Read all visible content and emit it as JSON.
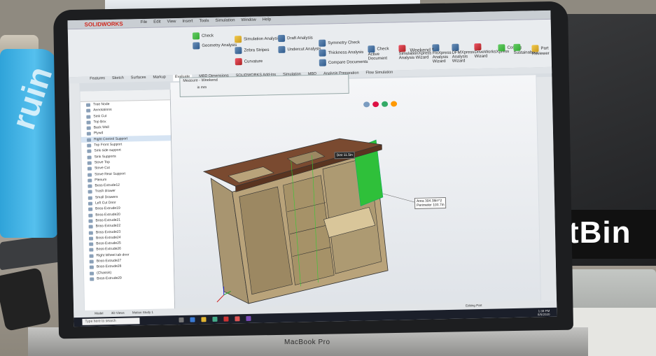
{
  "app": {
    "logo": "SOLIDWORKS",
    "menu": [
      "File",
      "Edit",
      "View",
      "Insert",
      "Tools",
      "Simulation",
      "Window",
      "Help"
    ],
    "document_title": "Weekend *"
  },
  "ribbon": {
    "tools": [
      {
        "label": "Check",
        "icon": "check-icon"
      },
      {
        "label": "Geometry Analysis",
        "icon": "geometry-analysis-icon"
      },
      {
        "label": "Simulation Analysis",
        "icon": "simulation-icon"
      },
      {
        "label": "Draft Analysis",
        "icon": "draft-icon"
      },
      {
        "label": "Zebra Stripes",
        "icon": "zebra-icon"
      },
      {
        "label": "Undercut Analysis",
        "icon": "undercut-icon"
      },
      {
        "label": "Curvature",
        "icon": "curvature-icon"
      },
      {
        "label": "Symmetry Check",
        "icon": "symmetry-icon"
      },
      {
        "label": "Thickness Analysis",
        "icon": "thickness-icon"
      },
      {
        "label": "Compare Documents",
        "icon": "compare-icon"
      },
      {
        "label": "Check Active Document",
        "icon": "check-doc-icon"
      },
      {
        "label": "SimulationXpress Analysis Wizard",
        "icon": "simxpress-icon"
      },
      {
        "label": "FloXpress Analysis Wizard",
        "icon": "floxpress-icon"
      },
      {
        "label": "DFMXpress Analysis Wizard",
        "icon": "dfm-icon"
      },
      {
        "label": "DriveWorksXpress Wizard",
        "icon": "driveworks-icon"
      },
      {
        "label": "Costing",
        "icon": "costing-icon"
      },
      {
        "label": "Sustainability",
        "icon": "sustain-icon"
      },
      {
        "label": "Part Reviewer",
        "icon": "reviewer-icon"
      }
    ]
  },
  "tabs": [
    "Features",
    "Sketch",
    "Surfaces",
    "Markup",
    "Evaluate",
    "MBD Dimensions",
    "SOLIDWORKS Add-Ins",
    "Simulation",
    "MBD",
    "Analysis Preparation",
    "Flow Simulation"
  ],
  "measure_panel": {
    "title": "Measure - Weekend",
    "unit_line": "in",
    "unit_sub": "mm"
  },
  "tree": {
    "items": [
      "Tree Node",
      "Annotations",
      "Sink Cut",
      "Top Box",
      "Back Wall",
      "Plywd",
      "Right Control Support",
      "Top Front Support",
      "Sink side support",
      "Sink Supports",
      "Stove Top",
      "Stove Cut",
      "Stove Rear Support",
      "Plenum",
      "Boss-Extrude12",
      "Trash drawer",
      "Small Drawers",
      "Left Cut Door",
      "Boss-Extrude19",
      "Boss-Extrude20",
      "Boss-Extrude21",
      "Boss-Extrude22",
      "Boss-Extrude23",
      "Boss-Extrude24",
      "Boss-Extrude25",
      "Boss-Extrude26",
      "Right Wheel tab door",
      "Boss-Extrude27",
      "Boss-Extrude28",
      "(Chassis)",
      "Boss-Extrude29"
    ],
    "selected_index": 6
  },
  "callouts": {
    "dist_label": "Dist",
    "dist_value": "11.5in",
    "area_label": "Area",
    "area_value": "304.38in^2",
    "perimeter_label": "Perimeter",
    "perimeter_value": "103.7in"
  },
  "status": [
    "Model",
    "3D Views",
    "Motion Study 1"
  ],
  "taskbar": {
    "search_placeholder": "Type here to search",
    "status_right": "Editing Part",
    "clock_time": "1:38 PM",
    "clock_date": "8/5/2020"
  },
  "laptop": {
    "brand": "MacBook Pro"
  },
  "background": {
    "case_brand": "tBin",
    "bottle_brand": "ruin"
  },
  "colors": {
    "accent": "#d0271d",
    "wood_top": "#7a4a30",
    "wood_body": "#b9a37a",
    "green_face": "#2fc03a"
  }
}
